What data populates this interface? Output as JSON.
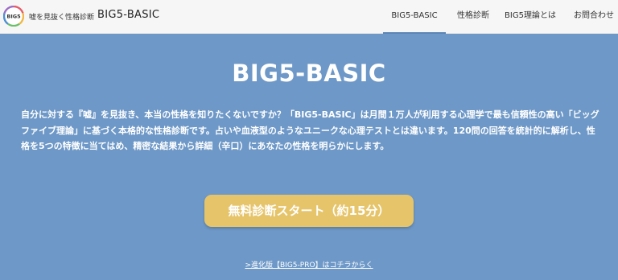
{
  "header": {
    "logo_text": "BIG5",
    "tagline": "嘘を見抜く性格診断",
    "brand": "BIG5-BASIC",
    "nav": [
      {
        "label": "BIG5-BASIC",
        "active": true
      },
      {
        "label": "性格診断",
        "active": false
      },
      {
        "label": "BIG5理論とは",
        "active": false
      },
      {
        "label": "お問合わせ",
        "active": false
      }
    ]
  },
  "hero": {
    "title": "BIG5-BASIC",
    "description": "自分に対する『嘘』を見抜き、本当の性格を知りたくないですか？「BIG5-BASIC」は月間１万人が利用する心理学で最も信頼性の高い「ビッグファイブ理論」に基づく本格的な性格診断です。占いや血液型のようなユニークな心理テストとは違います。120問の回答を統計的に解析し、性格を5つの特徴に当てはめ、精密な結果から詳細（辛口）にあなたの性格を明らかにします。",
    "cta_label": "無料診断スタート（約15分）",
    "pro_link": ">進化版【BIG5-PRO】はコチラからく"
  },
  "colors": {
    "hero_bg": "#6e98c7",
    "cta_bg": "#e6c46a",
    "header_bg": "#f6f6f6",
    "active_underline": "#5b85b5"
  }
}
